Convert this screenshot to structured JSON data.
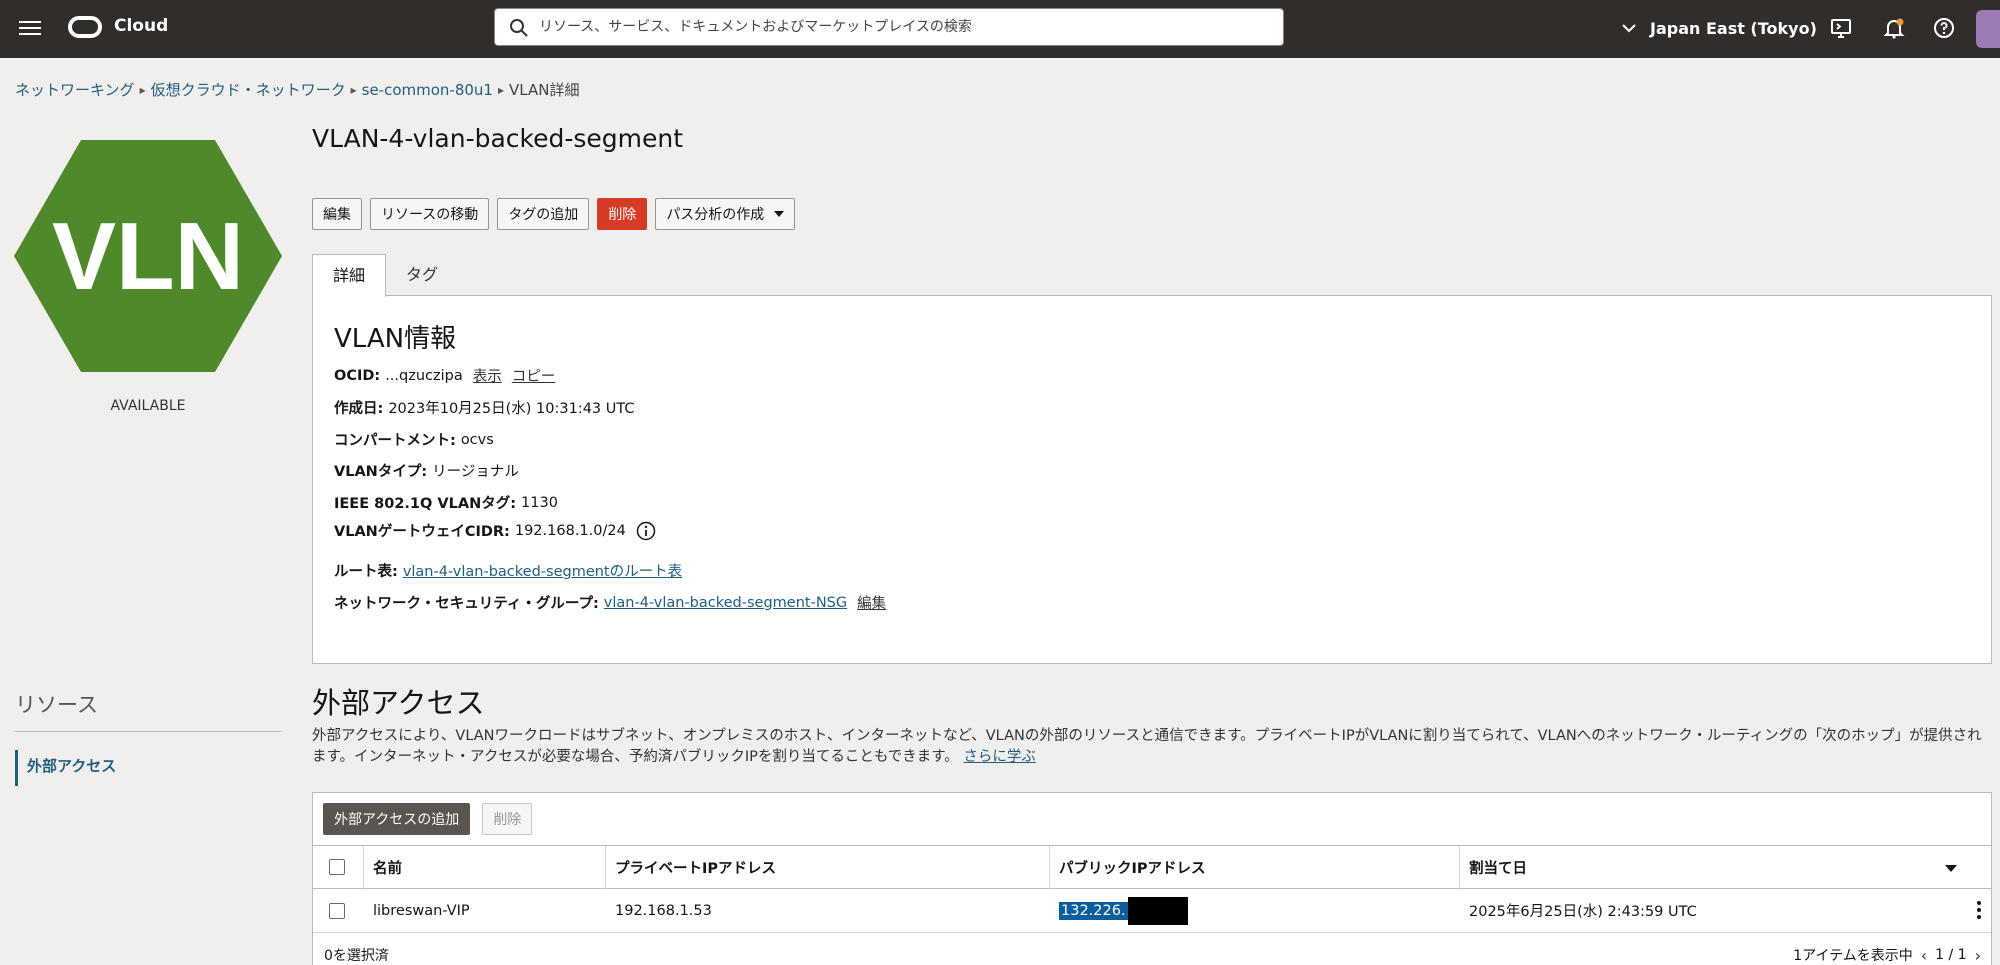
{
  "header": {
    "logo_text": "Cloud",
    "search_placeholder": "リソース、サービス、ドキュメントおよびマーケットプレイスの検索",
    "region": "Japan East (Tokyo)"
  },
  "breadcrumb": {
    "items": [
      "ネットワーキング",
      "仮想クラウド・ネットワーク",
      "se-common-80u1"
    ],
    "current": "VLAN詳細"
  },
  "resource": {
    "icon_text": "VLN",
    "status": "AVAILABLE",
    "title": "VLAN-4-vlan-backed-segment"
  },
  "actions": {
    "edit": "編集",
    "move": "リソースの移動",
    "add_tag": "タグの追加",
    "delete": "削除",
    "path_analysis": "パス分析の作成"
  },
  "tabs": [
    "詳細",
    "タグ"
  ],
  "info": {
    "heading": "VLAN情報",
    "ocid_label": "OCID:",
    "ocid_value": "...qzuczipa",
    "ocid_show": "表示",
    "ocid_copy": "コピー",
    "created_label": "作成日:",
    "created_value": "2023年10月25日(水) 10:31:43 UTC",
    "compartment_label": "コンパートメント:",
    "compartment_value": "ocvs",
    "type_label": "VLANタイプ:",
    "type_value": "リージョナル",
    "tag_label": "IEEE 802.1Q VLANタグ:",
    "tag_value": "1130",
    "cidr_label": "VLANゲートウェイCIDR:",
    "cidr_value": "192.168.1.0/24",
    "route_label": "ルート表:",
    "route_value": "vlan-4-vlan-backed-segmentのルート表",
    "nsg_label": "ネットワーク・セキュリティ・グループ:",
    "nsg_value": "vlan-4-vlan-backed-segment-NSG",
    "nsg_edit": "編集"
  },
  "resources_sidebar": {
    "title": "リソース",
    "items": [
      "外部アクセス"
    ]
  },
  "external_access": {
    "title": "外部アクセス",
    "description": "外部アクセスにより、VLANワークロードはサブネット、オンプレミスのホスト、インターネットなど、VLANの外部のリソースと通信できます。プライベートIPがVLANに割り当てられて、VLANへのネットワーク・ルーティングの「次のホップ」が提供されます。インターネット・アクセスが必要な場合、予約済パブリックIPを割り当てることもできます。",
    "learn_more": "さらに学ぶ",
    "add_button": "外部アクセスの追加",
    "delete_button": "削除",
    "columns": [
      "名前",
      "プライベートIPアドレス",
      "パブリックIPアドレス",
      "割当て日"
    ],
    "rows": [
      {
        "name": "libreswan-VIP",
        "private_ip": "192.168.1.53",
        "public_ip": "132.226.",
        "assigned": "2025年6月25日(水) 2:43:59 UTC"
      }
    ],
    "selected": "0を選択済",
    "showing": "1アイテムを表示中",
    "page": "1 / 1"
  },
  "colors": {
    "topbar": "#312d2a",
    "hex_green": "#4f8a2a",
    "link": "#1e5e80",
    "danger": "#d63b25"
  }
}
